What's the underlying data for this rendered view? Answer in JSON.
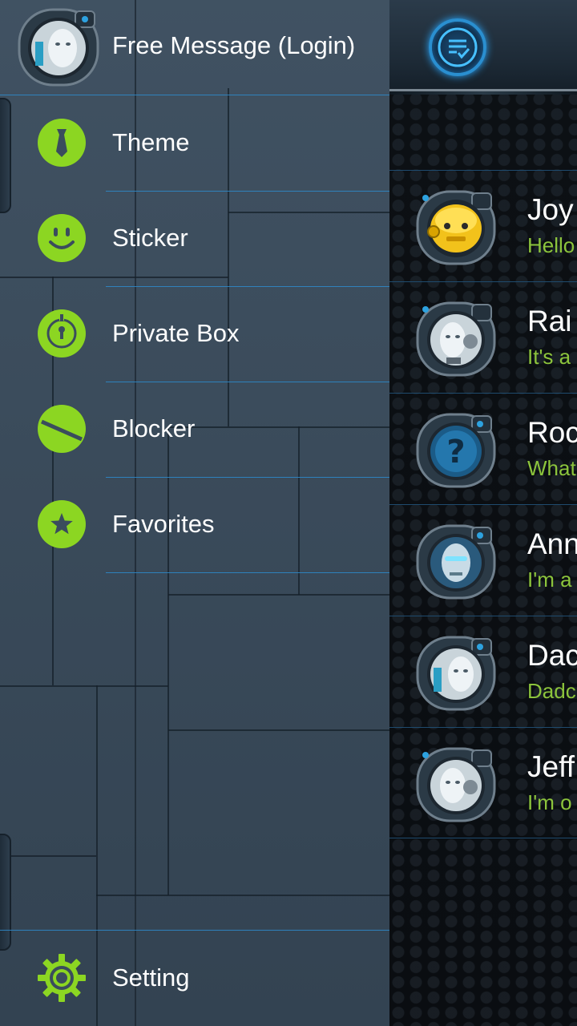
{
  "drawer": {
    "profile": {
      "label": "Free Message (Login)",
      "avatar_icon": "robot-avatar-icon"
    },
    "items": [
      {
        "id": "theme",
        "label": "Theme",
        "icon": "tie-icon"
      },
      {
        "id": "sticker",
        "label": "Sticker",
        "icon": "smiley-icon"
      },
      {
        "id": "private-box",
        "label": "Private Box",
        "icon": "keyhole-icon"
      },
      {
        "id": "blocker",
        "label": "Blocker",
        "icon": "blocked-icon"
      },
      {
        "id": "favorites",
        "label": "Favorites",
        "icon": "star-icon"
      }
    ],
    "setting": {
      "label": "Setting",
      "icon": "gear-icon"
    }
  },
  "header": {
    "compose_icon": "compose-message-icon"
  },
  "conversations": [
    {
      "name": "Joy",
      "snippet": "Hello",
      "avatar": "yellow-robot-avatar"
    },
    {
      "name": "Rai",
      "snippet": "It's a",
      "avatar": "robot-avatar"
    },
    {
      "name": "Roc",
      "snippet": "What",
      "avatar": "unknown-contact-avatar"
    },
    {
      "name": "Ann",
      "snippet": "I'm a",
      "avatar": "glowing-robot-avatar"
    },
    {
      "name": "Dac",
      "snippet": "Dadc",
      "avatar": "robot-avatar"
    },
    {
      "name": "Jeff",
      "snippet": "I'm o",
      "avatar": "robot-avatar"
    }
  ],
  "colors": {
    "accent_green": "#8cd622",
    "snippet_green": "#8cc43c",
    "divider_blue": "#2d87c7",
    "drawer_bg": "#3a4c5d",
    "list_bg": "#0c1014"
  }
}
